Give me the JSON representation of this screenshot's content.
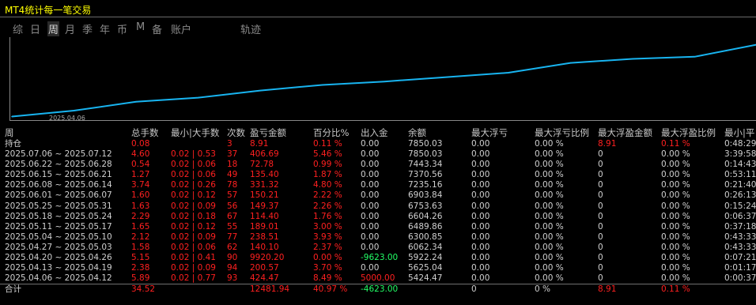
{
  "title": "MT4统计每一笔交易",
  "tabs": [
    {
      "label": "综",
      "active": false
    },
    {
      "label": "日",
      "active": false
    },
    {
      "label": "周",
      "active": true
    },
    {
      "label": "月",
      "active": false
    },
    {
      "label": "季",
      "active": false
    },
    {
      "label": "年",
      "active": false
    },
    {
      "label": "币",
      "active": false
    },
    {
      "label": "M",
      "active": false
    },
    {
      "label": "备",
      "active": false
    },
    {
      "label": "账户",
      "active": false
    },
    {
      "label": "轨迹",
      "active": false
    }
  ],
  "chart_data": {
    "type": "line",
    "x_tick_label": "2025.04.06",
    "x": [
      "2025.04.06",
      "2025.04.13",
      "2025.04.20",
      "2025.04.27",
      "2025.05.04",
      "2025.05.11",
      "2025.05.18",
      "2025.05.25",
      "2025.06.01",
      "2025.06.08",
      "2025.06.15",
      "2025.06.22",
      "2025.07.06"
    ],
    "values": [
      5424.47,
      5625.04,
      5922.24,
      6062.34,
      6300.85,
      6489.86,
      6604.26,
      6753.63,
      6903.84,
      7235.16,
      7370.56,
      7443.34,
      7850.03
    ],
    "color": "#18b4f0"
  },
  "columns": [
    "周",
    "总手数",
    "最小|大手数",
    "次数",
    "盈亏金额",
    "百分比%",
    "出入金",
    "余额",
    "最大浮亏",
    "最大浮亏比例",
    "最大浮盈金额",
    "最大浮盈比例",
    "最小|平"
  ],
  "rows": [
    [
      "持仓",
      "0.08",
      "",
      "3",
      "8.91",
      "0.11 %",
      "0.00",
      "7850.03",
      "0.00",
      "0.00 %",
      "8.91",
      "0.11 %",
      "0:48:29"
    ],
    [
      "2025.07.06 ~ 2025.07.12",
      "4.60",
      "0.02 | 0.53",
      "37",
      "406.69",
      "5.46 %",
      "0.00",
      "7850.03",
      "0.00",
      "0.00 %",
      "0",
      "0.00 %",
      "3:39:58"
    ],
    [
      "2025.06.22 ~ 2025.06.28",
      "0.54",
      "0.02 | 0.06",
      "18",
      "72.78",
      "0.99 %",
      "0.00",
      "7443.34",
      "0.00",
      "0.00 %",
      "0",
      "0.00 %",
      "0:14:43"
    ],
    [
      "2025.06.15 ~ 2025.06.21",
      "1.27",
      "0.02 | 0.06",
      "49",
      "135.40",
      "1.87 %",
      "0.00",
      "7370.56",
      "0.00",
      "0.00 %",
      "0",
      "0.00 %",
      "0:53:11"
    ],
    [
      "2025.06.08 ~ 2025.06.14",
      "3.74",
      "0.02 | 0.26",
      "78",
      "331.32",
      "4.80 %",
      "0.00",
      "7235.16",
      "0.00",
      "0.00 %",
      "0",
      "0.00 %",
      "0:21:40"
    ],
    [
      "2025.06.01 ~ 2025.06.07",
      "1.60",
      "0.02 | 0.12",
      "57",
      "150.21",
      "2.22 %",
      "0.00",
      "6903.84",
      "0.00",
      "0.00 %",
      "0",
      "0.00 %",
      "0:26:13"
    ],
    [
      "2025.05.25 ~ 2025.05.31",
      "1.63",
      "0.02 | 0.09",
      "56",
      "149.37",
      "2.26 %",
      "0.00",
      "6753.63",
      "0.00",
      "0.00 %",
      "0",
      "0.00 %",
      "0:15:24"
    ],
    [
      "2025.05.18 ~ 2025.05.24",
      "2.29",
      "0.02 | 0.18",
      "67",
      "114.40",
      "1.76 %",
      "0.00",
      "6604.26",
      "0.00",
      "0.00 %",
      "0",
      "0.00 %",
      "0:06:37"
    ],
    [
      "2025.05.11 ~ 2025.05.17",
      "1.65",
      "0.02 | 0.12",
      "55",
      "189.01",
      "3.00 %",
      "0.00",
      "6489.86",
      "0.00",
      "0.00 %",
      "0",
      "0.00 %",
      "0:37:18"
    ],
    [
      "2025.05.04 ~ 2025.05.10",
      "2.12",
      "0.02 | 0.09",
      "77",
      "238.51",
      "3.93 %",
      "0.00",
      "6300.85",
      "0.00",
      "0.00 %",
      "0",
      "0.00 %",
      "0:43:33"
    ],
    [
      "2025.04.27 ~ 2025.05.03",
      "1.58",
      "0.02 | 0.06",
      "62",
      "140.10",
      "2.37 %",
      "0.00",
      "6062.34",
      "0.00",
      "0.00 %",
      "0",
      "0.00 %",
      "0:43:33"
    ],
    [
      "2025.04.20 ~ 2025.04.26",
      "5.15",
      "0.02 | 0.41",
      "90",
      "9920.20",
      "0.00 %",
      "-9623.00",
      "5922.24",
      "0.00",
      "0.00 %",
      "0",
      "0.00 %",
      "0:07:21"
    ],
    [
      "2025.04.13 ~ 2025.04.19",
      "2.38",
      "0.02 | 0.09",
      "94",
      "200.57",
      "3.70 %",
      "0.00",
      "5625.04",
      "0.00",
      "0.00 %",
      "0",
      "0.00 %",
      "0:01:17"
    ],
    [
      "2025.04.06 ~ 2025.04.12",
      "5.89",
      "0.02 | 0.77",
      "93",
      "424.47",
      "8.49 %",
      "5000.00",
      "5424.47",
      "0.00",
      "0.00 %",
      "0",
      "0.00 %",
      "0:00:37"
    ]
  ],
  "total": [
    "合计",
    "34.52",
    "",
    "",
    "12481.94",
    "40.97 %",
    "-4623.00",
    "",
    "0",
    "0 %",
    "8.91",
    "0.11 %",
    ""
  ]
}
